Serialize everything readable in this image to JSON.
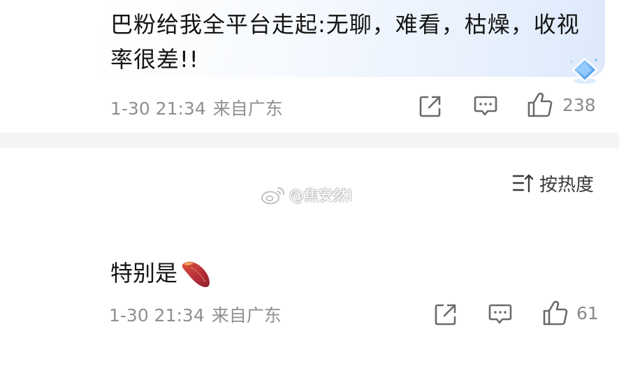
{
  "comment1": {
    "text": "巴粉给我全平台走起:无聊，难看，枯燥，收视率很差!!",
    "time": "1-30 21:34",
    "location": "来自广东",
    "likes": "238"
  },
  "sort": {
    "label": "按热度"
  },
  "watermark": {
    "text": "@焦安然l"
  },
  "comment2": {
    "text": "特别是",
    "time": "1-30 21:34",
    "location": "来自广东",
    "likes": "61"
  },
  "icons": {
    "share": "share-icon",
    "comment": "comment-icon",
    "like": "thumbs-up-icon",
    "sort": "sort-icon",
    "weibo": "weibo-logo-icon",
    "gem": "diamond-badge-icon",
    "emoji": "sweet-potato-emoji"
  },
  "colors": {
    "text": "#141414",
    "meta": "#8f8f8f",
    "separator": "#f3f4f6",
    "bubble_accent": "#dde9fb",
    "gem": "#6fb4f5"
  }
}
